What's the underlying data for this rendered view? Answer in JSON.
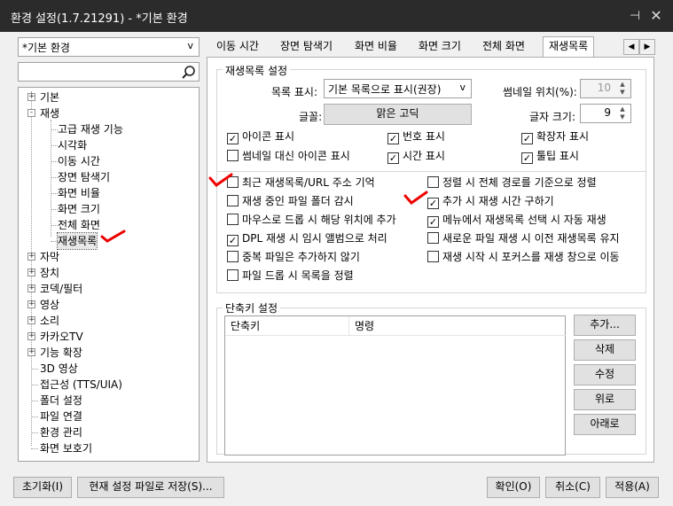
{
  "window": {
    "title": "환경 설정(1.7.21291) - *기본 환경"
  },
  "preset": {
    "value": "*기본 환경"
  },
  "tree": [
    {
      "label": "기본",
      "exp": "+"
    },
    {
      "label": "재생",
      "exp": "-"
    },
    {
      "label": "고급 재생 기능"
    },
    {
      "label": "시각화"
    },
    {
      "label": "이동 시간"
    },
    {
      "label": "장면 탐색기"
    },
    {
      "label": "화면 비율"
    },
    {
      "label": "화면 크기"
    },
    {
      "label": "전체 화면"
    },
    {
      "label": "재생목록"
    },
    {
      "label": "자막",
      "exp": "+"
    },
    {
      "label": "장치",
      "exp": "+"
    },
    {
      "label": "코덱/필터",
      "exp": "+"
    },
    {
      "label": "영상",
      "exp": "+"
    },
    {
      "label": "소리",
      "exp": "+"
    },
    {
      "label": "카카오TV",
      "exp": "+"
    },
    {
      "label": "기능 확장",
      "exp": "+"
    },
    {
      "label": "3D 영상"
    },
    {
      "label": "접근성 (TTS/UIA)"
    },
    {
      "label": "폴더 설정"
    },
    {
      "label": "파일 연결"
    },
    {
      "label": "환경 관리"
    },
    {
      "label": "화면 보호기"
    }
  ],
  "tabs": [
    "이동 시간",
    "장면 탐색기",
    "화면 비율",
    "화면 크기",
    "전체 화면",
    "재생목록"
  ],
  "playlist": {
    "group_title": "재생목록 설정",
    "display_label": "목록 표시:",
    "display_value": "기본 목록으로 표시(권장)",
    "thumb_pos_label": "썸네일 위치(%):",
    "thumb_pos_value": "10",
    "font_label": "글꼴:",
    "font_value": "맑은 고딕",
    "font_size_label": "글자 크기:",
    "font_size_value": "9",
    "checks_top": [
      {
        "label": "아이콘 표시",
        "checked": true
      },
      {
        "label": "번호 표시",
        "checked": true
      },
      {
        "label": "확장자 표시",
        "checked": true
      },
      {
        "label": "썸네일 대신 아이콘 표시",
        "checked": false
      },
      {
        "label": "시간 표시",
        "checked": true
      },
      {
        "label": "툴팁 표시",
        "checked": true
      }
    ],
    "checks_left": [
      {
        "label": "최근 재생목록/URL 주소 기억",
        "checked": false
      },
      {
        "label": "재생 중인 파일 폴더 감시",
        "checked": false
      },
      {
        "label": "마우스로 드롭 시 해당 위치에 추가",
        "checked": false
      },
      {
        "label": "DPL 재생 시 임시 앨범으로 처리",
        "checked": true
      },
      {
        "label": "중복 파일은 추가하지 않기",
        "checked": false
      },
      {
        "label": "파일 드롭 시 목록을 정렬",
        "checked": false
      }
    ],
    "checks_right": [
      {
        "label": "정렬 시 전체 경로를 기준으로 정렬",
        "checked": false
      },
      {
        "label": "추가 시 재생 시간 구하기",
        "checked": true
      },
      {
        "label": "메뉴에서 재생목록 선택 시 자동 재생",
        "checked": true
      },
      {
        "label": "새로운 파일 재생 시 이전 재생목록 유지",
        "checked": false
      },
      {
        "label": "재생 시작 시 포커스를 재생 창으로 이동",
        "checked": false
      }
    ]
  },
  "shortcut": {
    "group_title": "단축키 설정",
    "col_key": "단축키",
    "col_cmd": "명령",
    "buttons": [
      "추가...",
      "삭제",
      "수정",
      "위로",
      "아래로"
    ]
  },
  "footer": {
    "reset": "초기화(I)",
    "save_as": "현재 설정 파일로 저장(S)...",
    "ok": "확인(O)",
    "cancel": "취소(C)",
    "apply": "적용(A)"
  },
  "icons": {
    "search": "magnifier-icon",
    "pin": "pin-icon",
    "close": "close-icon"
  },
  "colors": {
    "titlebar": "#2b2b2b",
    "annotation": "#e00000"
  }
}
